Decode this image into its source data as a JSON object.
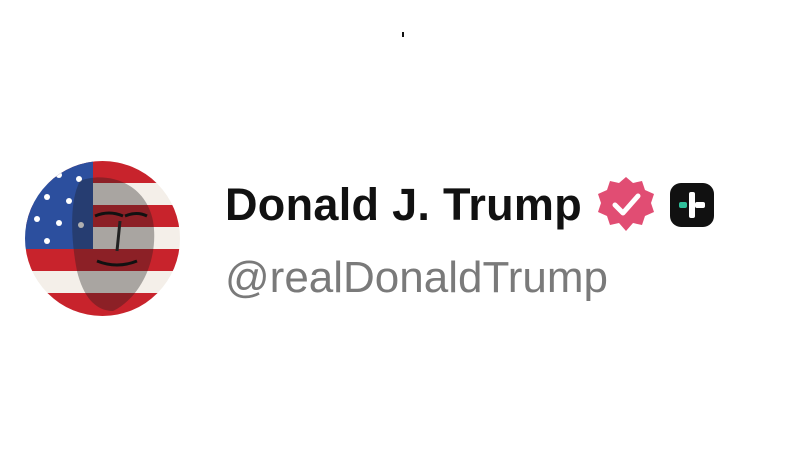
{
  "profile": {
    "display_name": "Donald J. Trump",
    "handle": "@realDonaldTrump",
    "avatar_icon": "flag-portrait-avatar",
    "verified_icon": "verified-badge-icon",
    "plus_icon": "plus-badge-icon"
  },
  "colors": {
    "verified_badge": "#e14d73",
    "plus_badge": "#111111",
    "plus_accent": "#2fbf9a",
    "name_text": "#111111",
    "handle_text": "#7a7a7a",
    "flag_red": "#c8232c",
    "flag_blue": "#2c4f9e"
  }
}
